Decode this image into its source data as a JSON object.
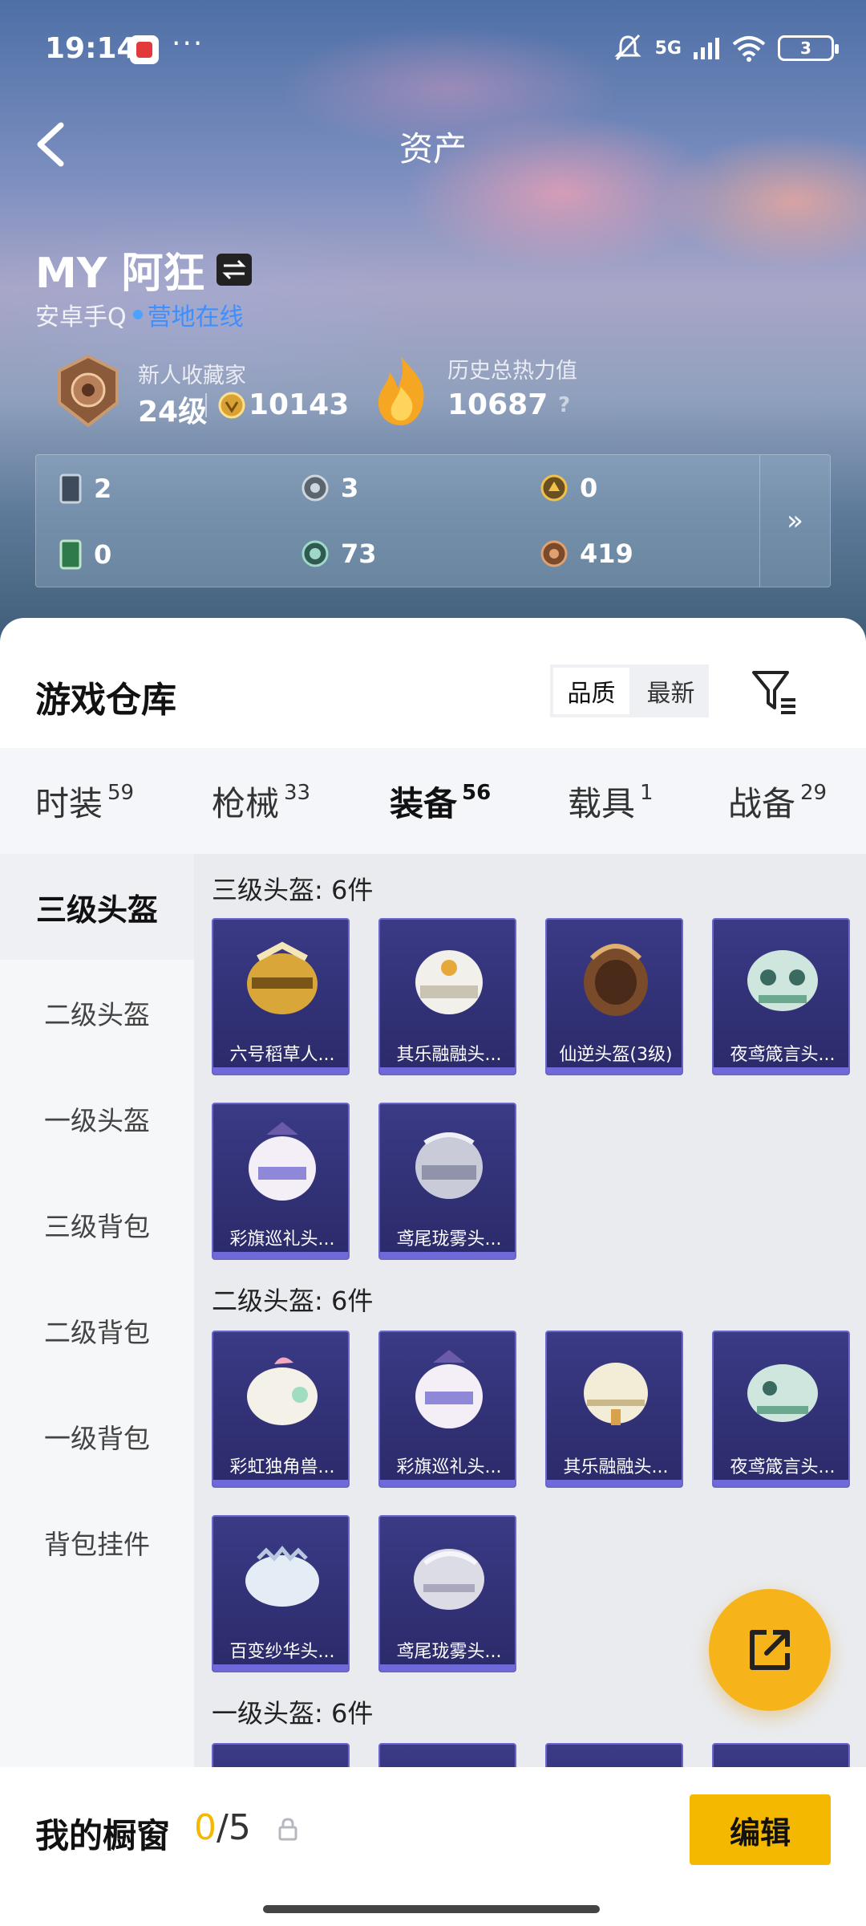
{
  "status": {
    "time": "19:14",
    "dots": "···",
    "network": "5G",
    "battery": "3"
  },
  "header": {
    "title": "资产"
  },
  "profile": {
    "name": "MY 阿狂",
    "platform": "安卓手Q",
    "online_status": "营地在线",
    "collector_title": "新人收藏家",
    "level": "24级",
    "coins": "10143",
    "heat_label": "历史总热力值",
    "heat_value": "10687",
    "help": "?"
  },
  "stats": [
    {
      "icon": "card-icon",
      "value": "2"
    },
    {
      "icon": "silver-medal-icon",
      "value": "3"
    },
    {
      "icon": "gold-medal-icon",
      "value": "0"
    },
    {
      "icon": "green-card-icon",
      "value": "0"
    },
    {
      "icon": "gem-icon",
      "value": "73"
    },
    {
      "icon": "bronze-coin-icon",
      "value": "419"
    }
  ],
  "stats_more": "»",
  "warehouse": {
    "title": "游戏仓库",
    "sort": [
      "品质",
      "最新"
    ],
    "tabs": [
      {
        "label": "时装",
        "count": "59"
      },
      {
        "label": "枪械",
        "count": "33"
      },
      {
        "label": "装备",
        "count": "56"
      },
      {
        "label": "载具",
        "count": "1"
      },
      {
        "label": "战备",
        "count": "29"
      }
    ],
    "categories": [
      "三级头盔",
      "二级头盔",
      "一级头盔",
      "三级背包",
      "二级背包",
      "一级背包",
      "背包挂件"
    ],
    "sections": [
      {
        "title": "三级头盔: 6件",
        "items": [
          "六号稻草人...",
          "其乐融融头...",
          "仙逆头盔(3级)",
          "夜鸢箴言头...",
          "彩旗巡礼头...",
          "鸢尾珑雾头..."
        ]
      },
      {
        "title": "二级头盔: 6件",
        "items": [
          "彩虹独角兽...",
          "彩旗巡礼头...",
          "其乐融融头...",
          "夜鸢箴言头...",
          "百变纱华头...",
          "鸢尾珑雾头..."
        ]
      },
      {
        "title": "一级头盔: 6件",
        "items": [
          "",
          "",
          "",
          ""
        ]
      }
    ]
  },
  "bottom": {
    "showcase_label": "我的橱窗",
    "current": "0",
    "total": "/5",
    "edit": "编辑"
  },
  "colors": {
    "accent": "#f5b800",
    "card_bg": "#2b2a69",
    "card_border": "#6b67c9",
    "online": "#3d8fff"
  }
}
